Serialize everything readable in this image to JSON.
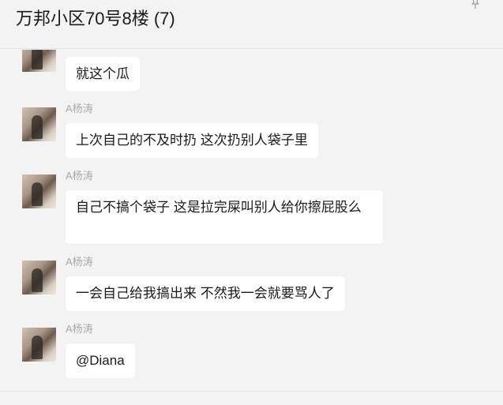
{
  "header": {
    "title": "万邦小区70号8楼 (7)"
  },
  "messages": [
    {
      "text": "就这个瓜"
    },
    {
      "sender": "A杨涛",
      "text": "上次自己的不及时扔 这次扔别人袋子里"
    },
    {
      "sender": "A杨涛",
      "text": "自己不搞个袋子   这是拉完屎叫别人给你擦屁股么"
    },
    {
      "sender": "A杨涛",
      "text": "一会自己给我搞出来  不然我一会就要骂人了"
    },
    {
      "sender": "A杨涛",
      "text": "@Diana"
    }
  ]
}
